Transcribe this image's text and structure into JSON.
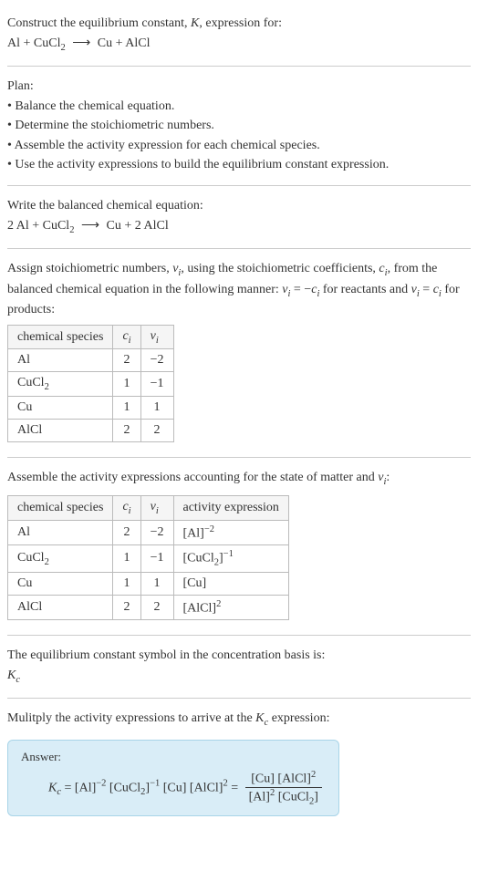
{
  "header": {
    "line1": "Construct the equilibrium constant, ",
    "Ksym": "K",
    "line1b": ", expression for:",
    "eq_lhs1": "Al + CuCl",
    "eq_sub1": "2",
    "eq_arrow": "⟶",
    "eq_rhs1": "Cu + AlCl"
  },
  "plan": {
    "title": "Plan:",
    "b1": "• Balance the chemical equation.",
    "b2": "• Determine the stoichiometric numbers.",
    "b3": "• Assemble the activity expression for each chemical species.",
    "b4": "• Use the activity expressions to build the equilibrium constant expression."
  },
  "balanced": {
    "title": "Write the balanced chemical equation:",
    "lhs": "2 Al + CuCl",
    "sub": "2",
    "arrow": "⟶",
    "rhs": "Cu + 2 AlCl"
  },
  "assign": {
    "text1": "Assign stoichiometric numbers, ",
    "nu": "ν",
    "sub_i": "i",
    "text2": ", using the stoichiometric coefficients, ",
    "c": "c",
    "text3": ", from the balanced chemical equation in the following manner: ",
    "eq1a": "ν",
    "eq1b": " = −",
    "eq1c": "c",
    "text4": " for reactants and ",
    "eq2a": "ν",
    "eq2b": " = ",
    "eq2c": "c",
    "text5": " for products:"
  },
  "table1": {
    "h1": "chemical species",
    "h2_a": "c",
    "h2_b": "i",
    "h3_a": "ν",
    "h3_b": "i",
    "rows": [
      {
        "sp": "Al",
        "c": "2",
        "nu": "−2"
      },
      {
        "sp_a": "CuCl",
        "sp_b": "2",
        "c": "1",
        "nu": "−1"
      },
      {
        "sp": "Cu",
        "c": "1",
        "nu": "1"
      },
      {
        "sp": "AlCl",
        "c": "2",
        "nu": "2"
      }
    ]
  },
  "activity": {
    "text1": "Assemble the activity expressions accounting for the state of matter and ",
    "nu": "ν",
    "sub_i": "i",
    "text2": ":"
  },
  "table2": {
    "h1": "chemical species",
    "h2_a": "c",
    "h2_b": "i",
    "h3_a": "ν",
    "h3_b": "i",
    "h4": "activity expression",
    "rows": [
      {
        "sp": "Al",
        "c": "2",
        "nu": "−2",
        "ae_base": "[Al]",
        "ae_exp": "−2"
      },
      {
        "sp_a": "CuCl",
        "sp_b": "2",
        "c": "1",
        "nu": "−1",
        "ae_base_a": "[CuCl",
        "ae_base_b": "2",
        "ae_base_c": "]",
        "ae_exp": "−1"
      },
      {
        "sp": "Cu",
        "c": "1",
        "nu": "1",
        "ae_base": "[Cu]"
      },
      {
        "sp": "AlCl",
        "c": "2",
        "nu": "2",
        "ae_base": "[AlCl]",
        "ae_exp": "2"
      }
    ]
  },
  "conc": {
    "text": "The equilibrium constant symbol in the concentration basis is:",
    "sym_a": "K",
    "sym_b": "c"
  },
  "multiply": {
    "text1": "Mulitply the activity expressions to arrive at the ",
    "Ka": "K",
    "Kb": "c",
    "text2": " expression:"
  },
  "answer": {
    "label": "Answer:",
    "Ka": "K",
    "Kb": "c",
    "eq": " = ",
    "t1": "[Al]",
    "e1": "−2",
    "t2": " [CuCl",
    "t2s": "2",
    "t2c": "]",
    "e2": "−1",
    "t3": " [Cu] [AlCl]",
    "e3": "2",
    "eq2": " = ",
    "num_a": "[Cu] [AlCl]",
    "num_e": "2",
    "den_a": "[Al]",
    "den_e": "2",
    "den_b": " [CuCl",
    "den_s": "2",
    "den_c": "]"
  }
}
